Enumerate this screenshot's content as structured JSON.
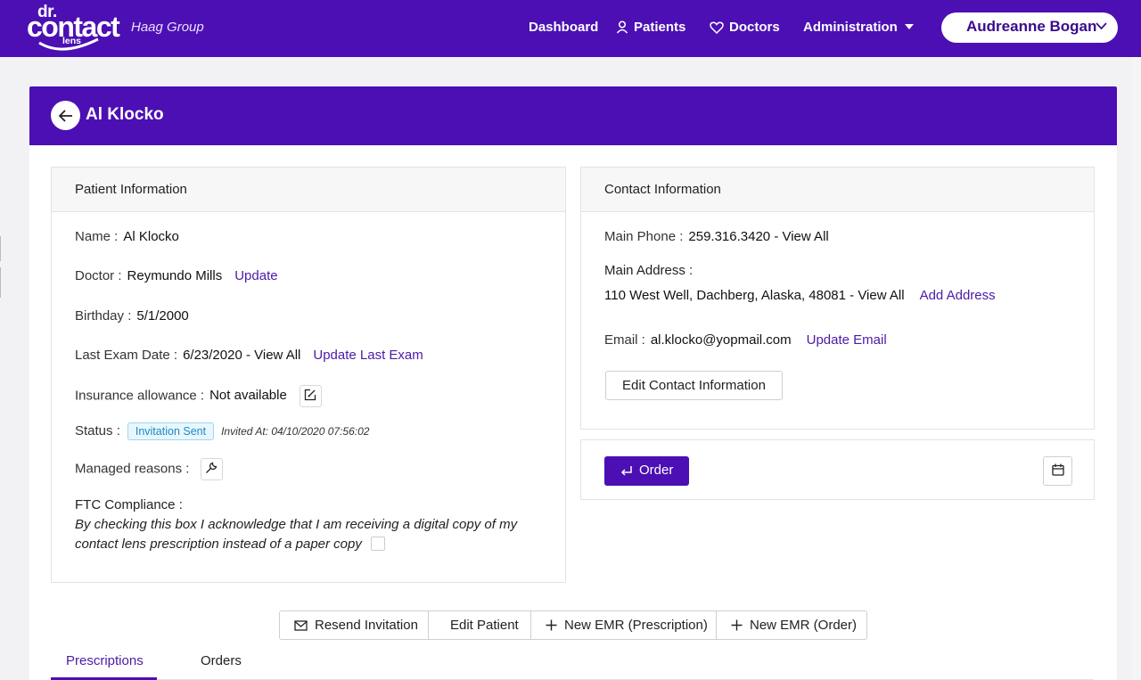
{
  "topbar": {
    "logo": {
      "dr": "dr.",
      "contact": "contact",
      "lens": "lens"
    },
    "company": "Haag Group",
    "nav": {
      "dashboard": "Dashboard",
      "patients": "Patients",
      "doctors": "Doctors",
      "administration": "Administration"
    },
    "user_name": "Audreanne Bogan",
    "brand_color": "#4c0fb3"
  },
  "header": {
    "patient_name": "Al Klocko"
  },
  "patient_info": {
    "title": "Patient Information",
    "name_label": "Name :",
    "name": "Al Klocko",
    "doctor_label": "Doctor :",
    "doctor": "Reymundo Mills",
    "doctor_update": "Update",
    "birthday_label": "Birthday :",
    "birthday": "5/1/2000",
    "last_exam_label": "Last Exam Date :",
    "last_exam": "6/23/2020 - View All",
    "last_exam_update": "Update Last Exam",
    "insurance_label": "Insurance allowance :",
    "insurance": "Not available",
    "status_label": "Status :",
    "status": "Invitation Sent",
    "invited_at": "Invited At: 04/10/2020 07:56:02",
    "managed_label": "Managed reasons :",
    "ftc_label": "FTC Compliance :",
    "ftc_text": "By checking this box I acknowledge that I am receiving a digital copy of my contact lens prescription instead of a paper copy",
    "ftc_checked": false
  },
  "contact_info": {
    "title": "Contact Information",
    "phone_label": "Main Phone :",
    "phone": "259.316.3420 - View All",
    "address_label": "Main Address :",
    "address": "110 West Well, Dachberg, Alaska, 48081 - View All",
    "add_address": "Add Address",
    "email_label": "Email :",
    "email": "al.klocko@yopmail.com",
    "update_email": "Update Email",
    "edit_button": "Edit Contact Information"
  },
  "order_panel": {
    "order_button": "Order"
  },
  "actions": {
    "resend": "Resend Invitation",
    "edit_patient": "Edit Patient",
    "new_emr_prescription": "New EMR (Prescription)",
    "new_emr_order": "New EMR (Order)"
  },
  "tabs": {
    "prescriptions": "Prescriptions",
    "orders": "Orders",
    "active": "Prescriptions"
  }
}
